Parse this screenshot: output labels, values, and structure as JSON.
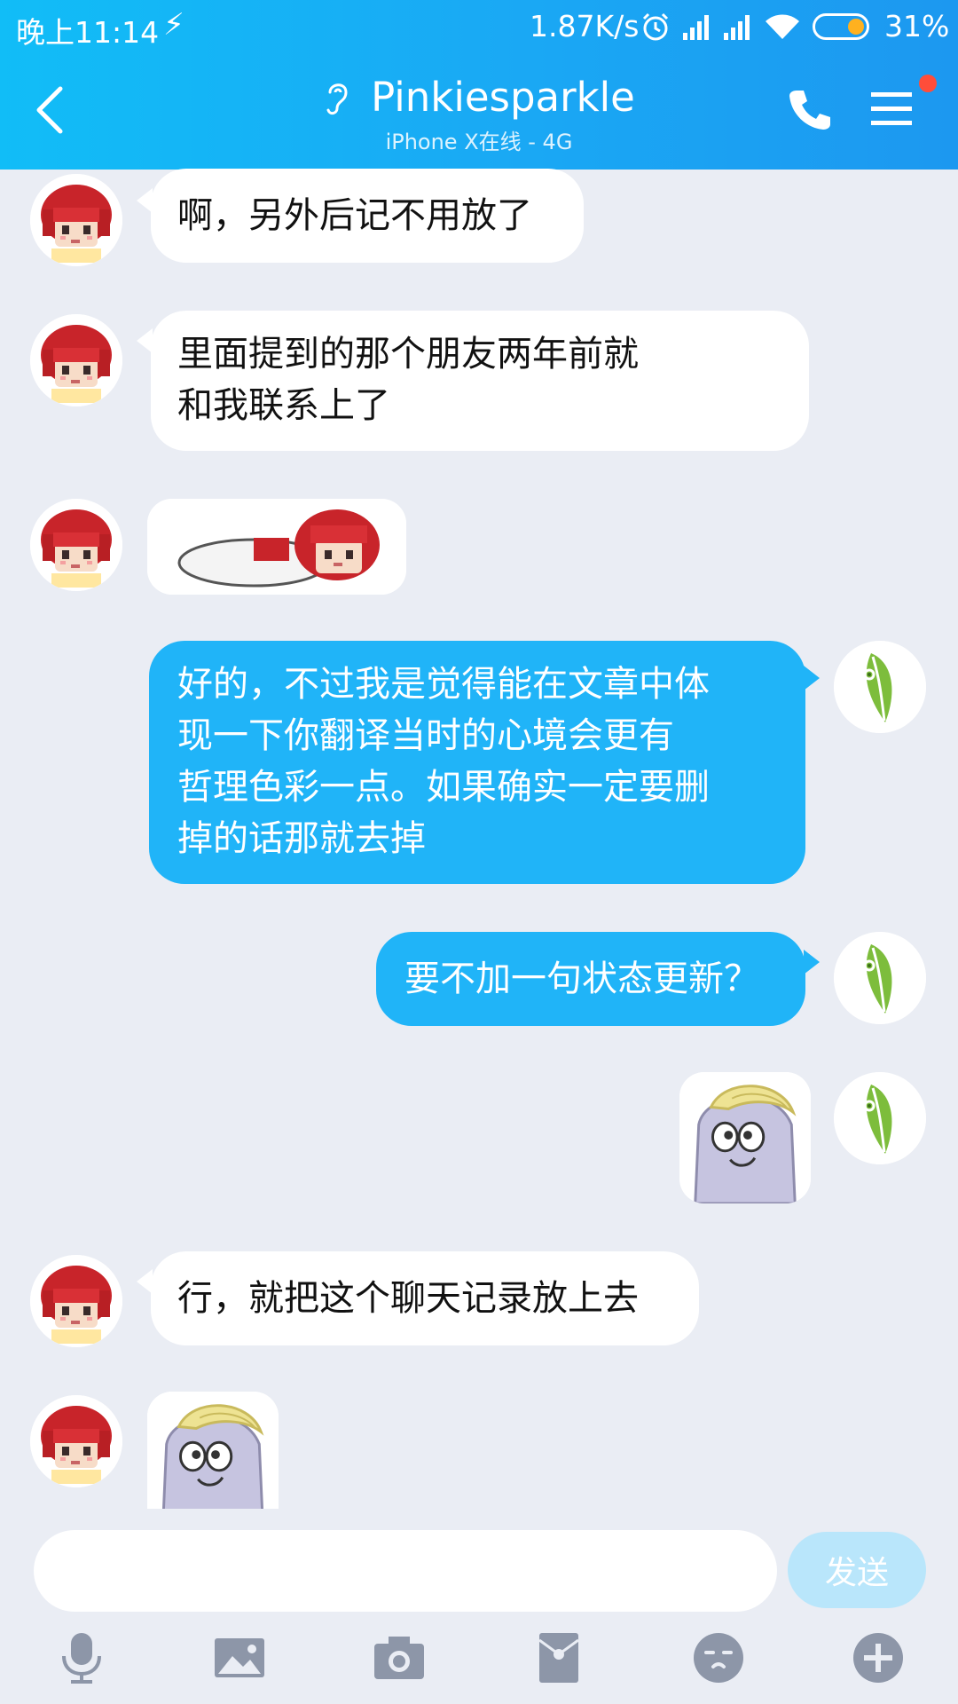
{
  "status_bar": {
    "time": "晚上11:14",
    "network_speed": "1.87K/s",
    "battery_percent": "31%",
    "icons": [
      "lightning-icon",
      "alarm-icon",
      "signal-icon",
      "signal-icon",
      "wifi-icon",
      "battery-icon"
    ]
  },
  "header": {
    "title": "Pinkiesparkle",
    "subtitle": "iPhone X在线 - 4G",
    "left_icon": "back-icon",
    "title_icon": "ear-icon",
    "right_icons": [
      "phone-icon",
      "menu-icon"
    ],
    "badge_color": "#ff4d3a"
  },
  "messages": [
    {
      "side": "in",
      "type": "text",
      "text": "啊，另外后记不用放了"
    },
    {
      "side": "in",
      "type": "text",
      "lines": [
        "里面提到的那个朋友两年前就",
        "和我联系上了"
      ]
    },
    {
      "side": "in",
      "type": "sticker",
      "sticker": "red-hair-girl-lying-sticker"
    },
    {
      "side": "out",
      "type": "text",
      "lines": [
        "好的，不过我是觉得能在文章中体",
        "现一下你翻译当时的心境会更有",
        "哲理色彩一点。如果确实一定要删",
        "掉的话那就去掉"
      ]
    },
    {
      "side": "out",
      "type": "text",
      "text": "要不加一句状态更新？"
    },
    {
      "side": "out",
      "type": "sticker",
      "sticker": "pony-face-sticker"
    },
    {
      "side": "in",
      "type": "text",
      "text": "行，就把这个聊天记录放上去"
    },
    {
      "side": "in",
      "type": "sticker",
      "sticker": "pony-face-sticker"
    }
  ],
  "input": {
    "value": "",
    "placeholder": ""
  },
  "send_button": {
    "label": "发送"
  },
  "toolbar": [
    "microphone-icon",
    "image-icon",
    "camera-icon",
    "red-packet-icon",
    "emoji-icon",
    "plus-icon"
  ],
  "colors": {
    "header_start": "#11bdf7",
    "header_end": "#1c98f0",
    "outgoing_bubble": "#20b4f8",
    "incoming_bubble": "#ffffff",
    "background": "#eaedf4",
    "send_button": "#b9e6fb"
  }
}
